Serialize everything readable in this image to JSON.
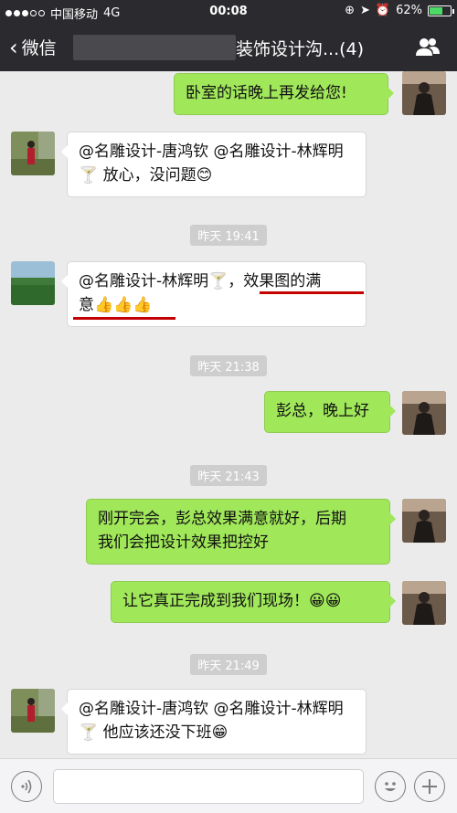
{
  "status_bar": {
    "carrier": "中国移动",
    "network": "4G",
    "time": "00:08",
    "battery_percent": "62%",
    "battery_level": 0.62
  },
  "nav": {
    "back_label": "微信",
    "title": "装饰设计沟...(4)",
    "people_icon": "group-icon"
  },
  "messages": [
    {
      "dir": "out",
      "text": "卧室的话晚上再发给您!"
    },
    {
      "dir": "in",
      "text": "@名雕设计-唐鸿钦 @名雕设计-林辉明🍸 放心，没问题😊"
    },
    {
      "dir": "in",
      "text_line1": "@名雕设计-林辉明🍸，效果图的满",
      "text_line2": "意👍👍👍"
    },
    {
      "dir": "out",
      "text": "彭总，晚上好"
    },
    {
      "dir": "out",
      "text_line1": "刚开完会，彭总效果满意就好，后期",
      "text_line2": "我们会把设计效果把控好"
    },
    {
      "dir": "out",
      "text": "让它真正完成到我们现场！😀😀"
    },
    {
      "dir": "in",
      "text": "@名雕设计-唐鸿钦 @名雕设计-林辉明🍸 他应该还没下班😁"
    }
  ],
  "timestamps": [
    "昨天 19:41",
    "昨天 21:38",
    "昨天 21:43",
    "昨天 21:49"
  ],
  "colors": {
    "nav_bg": "#2b2b2f",
    "outgoing_bubble": "#a0e75a",
    "incoming_bubble": "#ffffff",
    "chat_bg": "#ebebeb",
    "annotation_red": "#c40000"
  }
}
